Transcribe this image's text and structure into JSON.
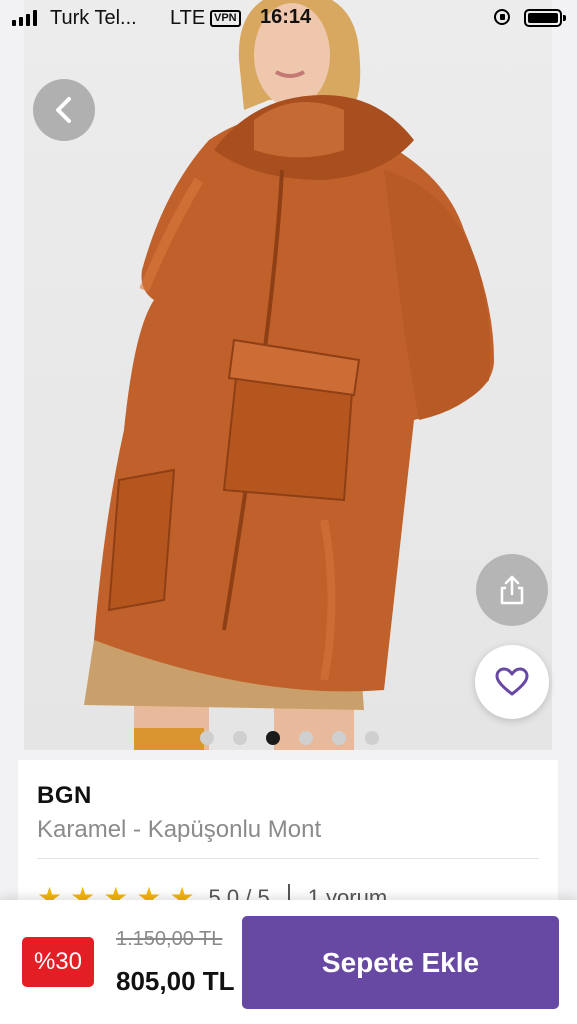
{
  "status_bar": {
    "carrier": "Turk Tel...",
    "network": "LTE",
    "vpn": "VPN",
    "time": "16:14"
  },
  "product": {
    "brand": "BGN",
    "name": "Karamel - Kapüşonlu Mont",
    "rating_text": "5.0 / 5",
    "rating_value": 5,
    "reviews_text": "1 yorum",
    "image_count": 6,
    "active_image_index": 2
  },
  "price": {
    "discount": "%30",
    "old_price": "1.150,00 TL",
    "new_price": "805,00 TL"
  },
  "actions": {
    "add_to_cart": "Sepete Ekle"
  },
  "icons": {
    "back": "chevron-left-icon",
    "share": "share-icon",
    "favorite": "heart-icon",
    "star": "star-icon"
  },
  "colors": {
    "accent": "#6749a3",
    "discount": "#e31e24",
    "star": "#f5b50a",
    "jacket": "#c0602a"
  }
}
